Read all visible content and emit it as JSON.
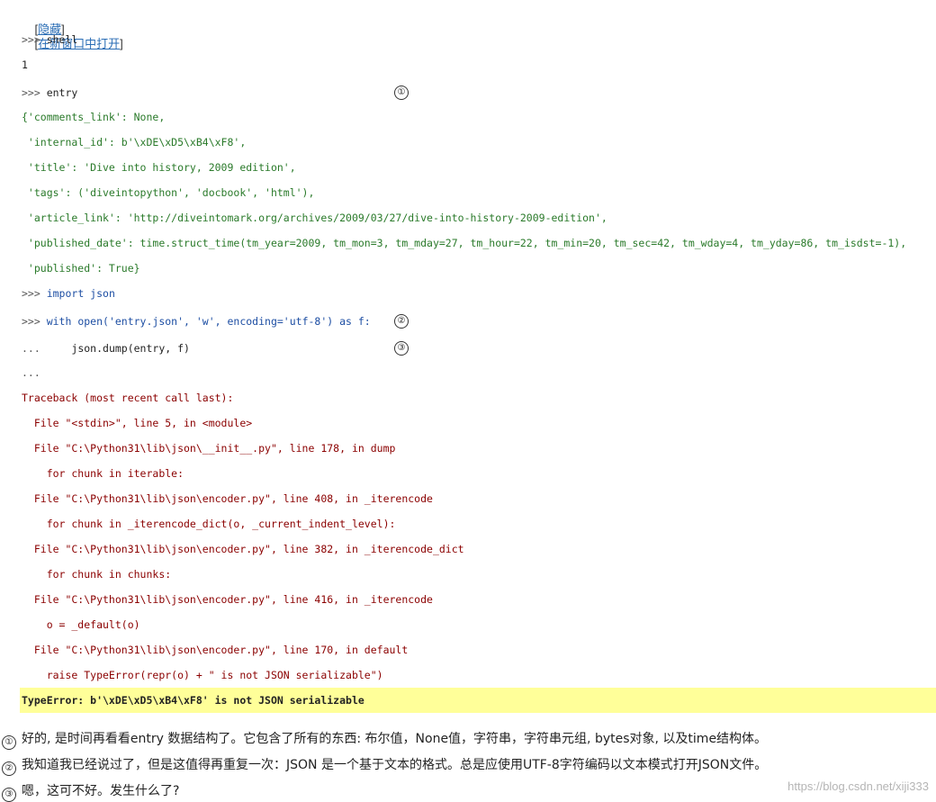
{
  "top_links": {
    "hide": "隐藏",
    "open_new_window": "在新窗口中打开",
    "bracket_open": "[",
    "bracket_close": "]"
  },
  "code_lines": [
    {
      "prompt": ">>> ",
      "text": "shell"
    },
    {
      "prompt": "",
      "text": "1"
    },
    {
      "prompt": ">>> ",
      "text": "entry"
    },
    {
      "prompt": "",
      "text": "{'comments_link': None,"
    },
    {
      "prompt": "",
      "text": " 'internal_id': b'\\xDE\\xD5\\xB4\\xF8',"
    },
    {
      "prompt": "",
      "text": " 'title': 'Dive into history, 2009 edition',"
    },
    {
      "prompt": "",
      "text": " 'tags': ('diveintopython', 'docbook', 'html'),"
    },
    {
      "prompt": "",
      "text": " 'article_link': 'http://diveintomark.org/archives/2009/03/27/dive-into-history-2009-edition',"
    },
    {
      "prompt": "",
      "text": " 'published_date': time.struct_time(tm_year=2009, tm_mon=3, tm_mday=27, tm_hour=22, tm_min=20, tm_sec=42, tm_wday=4, tm_yday=86, tm_isdst=-1),"
    },
    {
      "prompt": "",
      "text": " 'published': True}"
    },
    {
      "prompt": ">>> ",
      "text": "import json"
    },
    {
      "prompt": ">>> ",
      "text": "with open('entry.json', 'w', encoding='utf-8') as f:"
    },
    {
      "prompt": "... ",
      "text": "    json.dump(entry, f)"
    },
    {
      "prompt": "...",
      "text": ""
    }
  ],
  "traceback": [
    "Traceback (most recent call last):",
    "  File \"<stdin>\", line 5, in <module>",
    "  File \"C:\\Python31\\lib\\json\\__init__.py\", line 178, in dump",
    "    for chunk in iterable:",
    "  File \"C:\\Python31\\lib\\json\\encoder.py\", line 408, in _iterencode",
    "    for chunk in _iterencode_dict(o, _current_indent_level):",
    "  File \"C:\\Python31\\lib\\json\\encoder.py\", line 382, in _iterencode_dict",
    "    for chunk in chunks:",
    "  File \"C:\\Python31\\lib\\json\\encoder.py\", line 416, in _iterencode",
    "    o = _default(o)",
    "  File \"C:\\Python31\\lib\\json\\encoder.py\", line 170, in default",
    "    raise TypeError(repr(o) + \" is not JSON serializable\")"
  ],
  "error_line": "TypeError: b'\\xDE\\xD5\\xB4\\xF8' is not JSON serializable",
  "markers": [
    "①",
    "②",
    "③"
  ],
  "notes": [
    {
      "marker": "①",
      "text": "好的, 是时间再看看entry 数据结构了。它包含了所有的东西: 布尔值，None值，字符串，字符串元组, bytes对象, 以及time结构体。"
    },
    {
      "marker": "②",
      "text": "我知道我已经说过了，但是这值得再重复一次：JSON 是一个基于文本的格式。总是应使用UTF-8字符编码以文本模式打开JSON文件。"
    },
    {
      "marker": "③",
      "text": "嗯，这可不好。发生什么了?"
    }
  ],
  "watermark": "https://blog.csdn.net/xiji333",
  "colors": {
    "link": "#2a6db5",
    "keyword": "#1d4ea3",
    "string": "#2a7a2a",
    "traceback": "#8b0000",
    "error_highlight": "#ffff99"
  }
}
